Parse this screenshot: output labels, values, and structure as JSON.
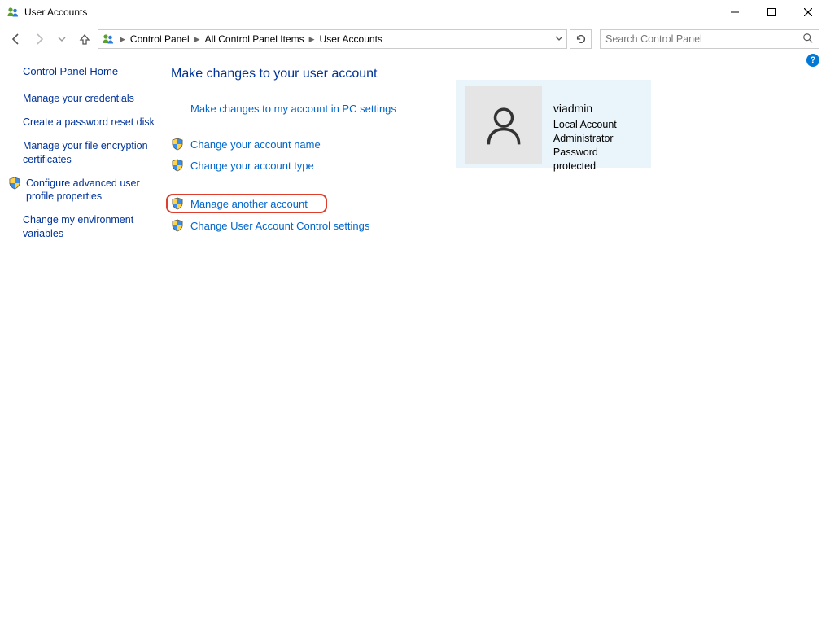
{
  "window": {
    "title": "User Accounts"
  },
  "breadcrumbs": {
    "items": [
      "Control Panel",
      "All Control Panel Items",
      "User Accounts"
    ]
  },
  "search": {
    "placeholder": "Search Control Panel"
  },
  "sidebar": {
    "home": "Control Panel Home",
    "links": [
      {
        "label": "Manage your credentials",
        "shield": false
      },
      {
        "label": "Create a password reset disk",
        "shield": false
      },
      {
        "label": "Manage your file encryption certificates",
        "shield": false
      },
      {
        "label": "Configure advanced user profile properties",
        "shield": true
      },
      {
        "label": "Change my environment variables",
        "shield": false
      }
    ]
  },
  "main": {
    "heading": "Make changes to your user account",
    "group1": [
      {
        "label": "Make changes to my account in PC settings",
        "shield": false
      }
    ],
    "group2": [
      {
        "label": "Change your account name",
        "shield": true
      },
      {
        "label": "Change your account type",
        "shield": true
      }
    ],
    "group3_highlight": {
      "label": "Manage another account",
      "shield": true
    },
    "group3_rest": [
      {
        "label": "Change User Account Control settings",
        "shield": true
      }
    ]
  },
  "user": {
    "name": "viadmin",
    "lines": [
      "Local Account",
      "Administrator",
      "Password protected"
    ]
  }
}
